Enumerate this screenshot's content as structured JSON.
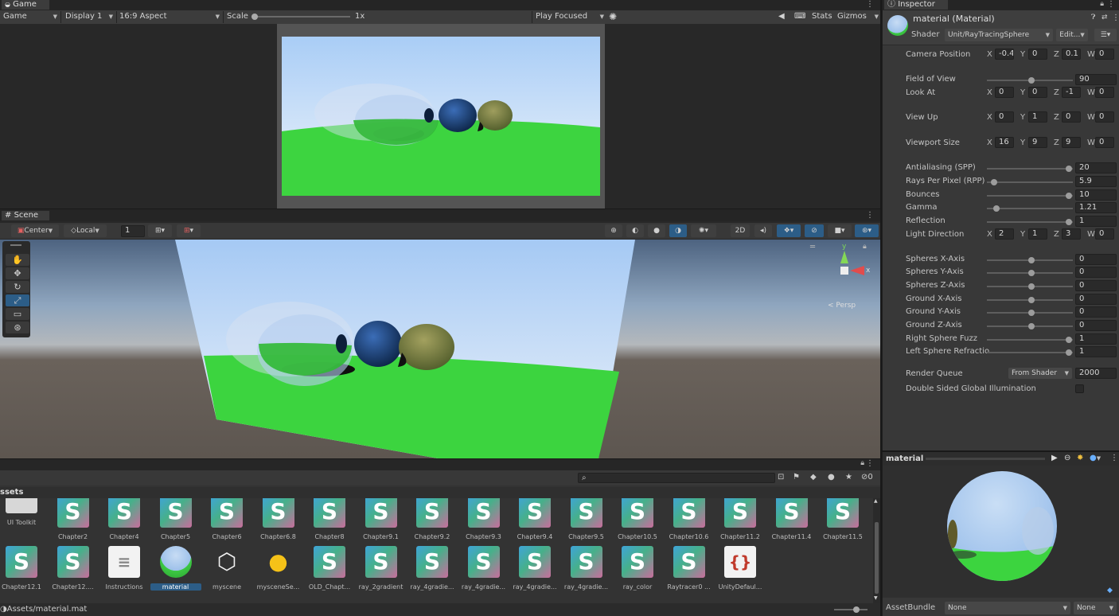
{
  "game": {
    "tab": "Game",
    "mode": "Game",
    "display": "Display 1",
    "aspect": "16:9 Aspect",
    "scale_label": "Scale",
    "scale_value": "1x",
    "play_mode": "Play Focused",
    "stats": "Stats",
    "gizmos": "Gizmos"
  },
  "scene": {
    "tab": "Scene",
    "pivot": "Center",
    "space": "Local",
    "grid_value": "1",
    "btn_2d": "2D",
    "persp": "< Persp",
    "gizmo_y": "y",
    "gizmo_x": "x"
  },
  "inspector": {
    "tab": "Inspector",
    "title": "material (Material)",
    "shader_label": "Shader",
    "shader_value": "Unit/RayTracingSphere",
    "edit_label": "Edit...",
    "vectors": [
      {
        "label": "Camera Position",
        "x": "-0.4",
        "y": "0",
        "z": "0.1",
        "w": "0"
      },
      {
        "label": "Look At",
        "x": "0",
        "y": "0",
        "z": "-1",
        "w": "0"
      },
      {
        "label": "View Up",
        "x": "0",
        "y": "1",
        "z": "0",
        "w": "0"
      },
      {
        "label": "Viewport Size",
        "x": "16",
        "y": "9",
        "z": "9",
        "w": "0"
      },
      {
        "label": "Light Direction",
        "x": "2",
        "y": "1",
        "z": "3",
        "w": "0"
      }
    ],
    "sliders": [
      {
        "label": "Field of View",
        "value": "90",
        "pos": 0.5
      },
      {
        "label": "Antialiasing (SPP)",
        "value": "20",
        "pos": 0.95
      },
      {
        "label": "Rays Per Pixel (RPP)",
        "value": "5.9",
        "pos": 0.05
      },
      {
        "label": "Bounces",
        "value": "10",
        "pos": 0.95
      },
      {
        "label": "Gamma",
        "value": "1.21",
        "pos": 0.08
      },
      {
        "label": "Reflection",
        "value": "1",
        "pos": 0.95
      },
      {
        "label": "Spheres X-Axis",
        "value": "0",
        "pos": 0.5
      },
      {
        "label": "Spheres Y-Axis",
        "value": "0",
        "pos": 0.5
      },
      {
        "label": "Spheres Z-Axis",
        "value": "0",
        "pos": 0.5
      },
      {
        "label": "Ground X-Axis",
        "value": "0",
        "pos": 0.5
      },
      {
        "label": "Ground Y-Axis",
        "value": "0",
        "pos": 0.5
      },
      {
        "label": "Ground Z-Axis",
        "value": "0",
        "pos": 0.5
      },
      {
        "label": "Right Sphere Fuzz",
        "value": "1",
        "pos": 0.95
      },
      {
        "label": "Left Sphere Refractio",
        "value": "1",
        "pos": 0.95
      }
    ],
    "axis_labels": {
      "x": "X",
      "y": "Y",
      "z": "Z",
      "w": "W"
    },
    "render_queue_label": "Render Queue",
    "render_queue_mode": "From Shader",
    "render_queue_value": "2000",
    "dsgi_label": "Double Sided Global Illumination"
  },
  "preview": {
    "title": "material",
    "assetbundle_label": "AssetBundle",
    "assetbundle_value": "None",
    "variant_value": "None"
  },
  "project": {
    "breadcrumb": "ssets",
    "status_path": "Assets/material.mat",
    "hidden_count": "0",
    "row1": [
      {
        "name": "UI Toolkit",
        "kind": "folder"
      },
      {
        "name": "Chapter2",
        "kind": "shader"
      },
      {
        "name": "Chapter4",
        "kind": "shader"
      },
      {
        "name": "Chapter5",
        "kind": "shader"
      },
      {
        "name": "Chapter6",
        "kind": "shader"
      },
      {
        "name": "Chapter6.8",
        "kind": "shader"
      },
      {
        "name": "Chapter8",
        "kind": "shader"
      },
      {
        "name": "Chapter9.1",
        "kind": "shader"
      },
      {
        "name": "Chapter9.2",
        "kind": "shader"
      },
      {
        "name": "Chapter9.3",
        "kind": "shader"
      },
      {
        "name": "Chapter9.4",
        "kind": "shader"
      },
      {
        "name": "Chapter9.5",
        "kind": "shader"
      },
      {
        "name": "Chapter10.5",
        "kind": "shader"
      },
      {
        "name": "Chapter10.6",
        "kind": "shader"
      },
      {
        "name": "Chapter11.2",
        "kind": "shader"
      },
      {
        "name": "Chapter11.4",
        "kind": "shader"
      },
      {
        "name": "Chapter11.5",
        "kind": "shader"
      }
    ],
    "row2": [
      {
        "name": "Chapter12.1",
        "kind": "shader"
      },
      {
        "name": "Chapter12....",
        "kind": "shader"
      },
      {
        "name": "Instructions",
        "kind": "doc"
      },
      {
        "name": "material",
        "kind": "material"
      },
      {
        "name": "myscene",
        "kind": "unity"
      },
      {
        "name": "mysceneSe...",
        "kind": "light"
      },
      {
        "name": "OLD_Chapt...",
        "kind": "shader"
      },
      {
        "name": "ray_2gradient",
        "kind": "shader"
      },
      {
        "name": "ray_4gradie...",
        "kind": "shader"
      },
      {
        "name": "ray_4gradie...",
        "kind": "shader"
      },
      {
        "name": "ray_4gradie...",
        "kind": "shader"
      },
      {
        "name": "ray_4gradie...",
        "kind": "shader"
      },
      {
        "name": "ray_color",
        "kind": "shader"
      },
      {
        "name": "Raytracer0 ...",
        "kind": "shader"
      },
      {
        "name": "UnityDefaul...",
        "kind": "json"
      }
    ],
    "shader_letter": "S",
    "json_glyph": "{}"
  },
  "colors": {
    "selection": "#2c5d87",
    "sky": "#a9cdf6",
    "ground": "#3cd340",
    "panel": "#383838"
  }
}
